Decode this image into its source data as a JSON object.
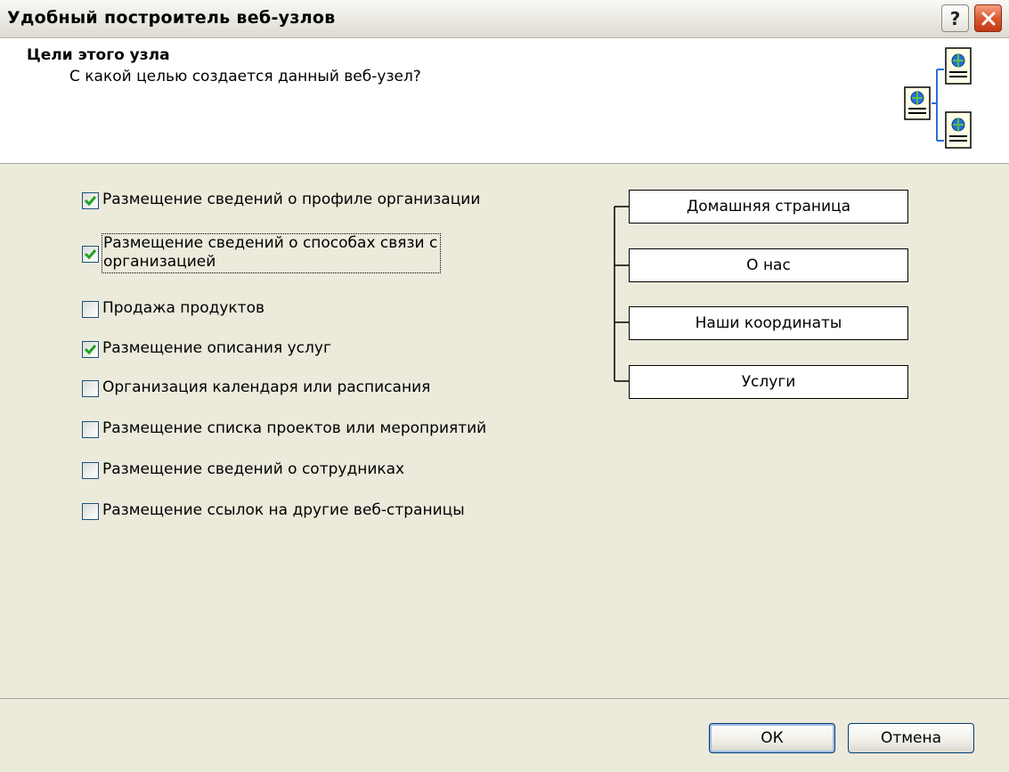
{
  "window": {
    "title": "Удобный построитель веб-узлов",
    "help_label": "?"
  },
  "header": {
    "title": "Цели этого узла",
    "subtitle": "С какой целью создается данный веб-узел?"
  },
  "options": [
    {
      "label": "Размещение сведений о профиле организации",
      "checked": true
    },
    {
      "label": "Размещение сведений о способах связи с",
      "label_line2": "организацией",
      "checked": true
    },
    {
      "label": "Продажа продуктов",
      "checked": false
    },
    {
      "label": "Размещение описания услуг",
      "checked": true
    },
    {
      "label": "Организация календаря или расписания",
      "checked": false
    },
    {
      "label": "Размещение списка проектов или мероприятий",
      "checked": false
    },
    {
      "label": "Размещение сведений о сотрудниках",
      "checked": false
    },
    {
      "label": "Размещение ссылок на другие веб-страницы",
      "checked": false
    }
  ],
  "site_map": {
    "pages": [
      "Домашняя страница",
      "О нас",
      "Наши координаты",
      "Услуги"
    ]
  },
  "footer": {
    "ok_label": "ОК",
    "cancel_label": "Отмена"
  },
  "colors": {
    "check_mark": "#21a121",
    "checkbox_border": "#1c5180",
    "dialog_bg": "#ebeadb",
    "close_button": "#d8542c"
  }
}
